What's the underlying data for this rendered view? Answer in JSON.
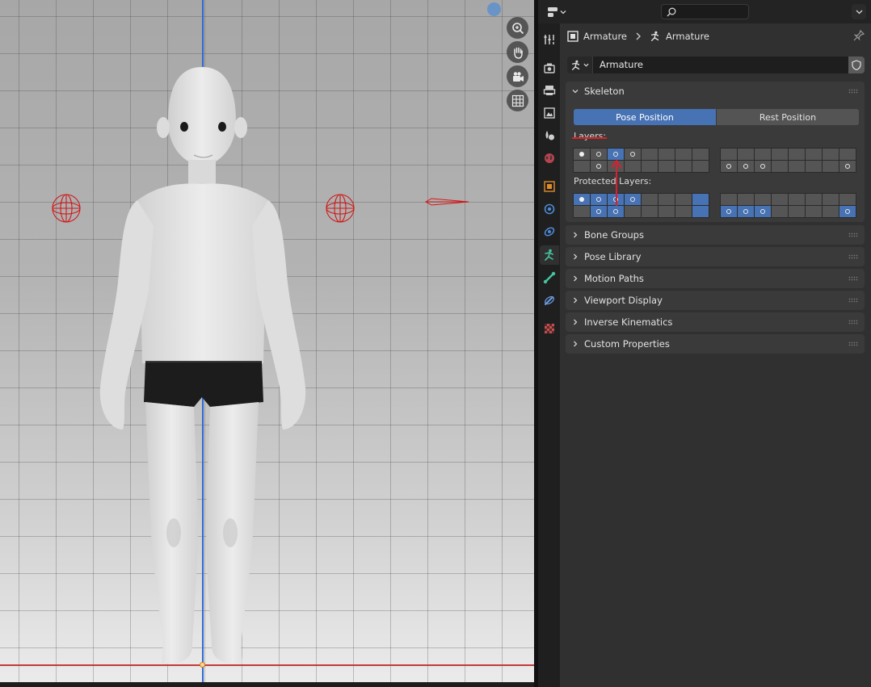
{
  "viewport": {
    "icons": [
      "zoom-icon",
      "hand-pan-icon",
      "camera-icon",
      "grid-icon"
    ]
  },
  "header": {
    "editor_type_icon": "editor-type-icon",
    "search_placeholder": ""
  },
  "breadcrumb": {
    "object_name": "Armature",
    "data_name": "Armature"
  },
  "datablock": {
    "name": "Armature"
  },
  "skeleton": {
    "title": "Skeleton",
    "pose_position": "Pose Position",
    "rest_position": "Rest Position",
    "layers_label": "Layers:",
    "protected_label": "Protected Layers:"
  },
  "panels": [
    {
      "title": "Bone Groups"
    },
    {
      "title": "Pose Library"
    },
    {
      "title": "Motion Paths"
    },
    {
      "title": "Viewport Display"
    },
    {
      "title": "Inverse Kinematics"
    },
    {
      "title": "Custom Properties"
    }
  ],
  "layers": {
    "row1_left": [
      "filled",
      "dot",
      "sel-dot",
      "dot",
      "",
      "",
      "",
      ""
    ],
    "row2_left": [
      "",
      "dot",
      "",
      "",
      "",
      "",
      "",
      ""
    ],
    "row1_right": [
      "",
      "",
      "",
      "",
      "",
      "",
      "",
      ""
    ],
    "row2_right": [
      "dot",
      "dot",
      "dot",
      "",
      "",
      "",
      "",
      "dot"
    ],
    "prot_row1_left": [
      "sel-filled",
      "sel-dot",
      "sel-dot",
      "sel-dot",
      "",
      "",
      "",
      "sel"
    ],
    "prot_row2_left": [
      "",
      "sel-dot",
      "sel-dot",
      "",
      "",
      "",
      "",
      "sel"
    ],
    "prot_row1_right": [
      "",
      "",
      "",
      "",
      "",
      "",
      "",
      ""
    ],
    "prot_row2_right": [
      "sel-dot",
      "sel-dot",
      "sel-dot",
      "",
      "",
      "",
      "",
      "sel-dot"
    ]
  },
  "colors": {
    "accent": "#4772b3",
    "annotation": "#e02020",
    "z_axis": "#2f6ad6",
    "x_axis": "#c23a3a"
  }
}
